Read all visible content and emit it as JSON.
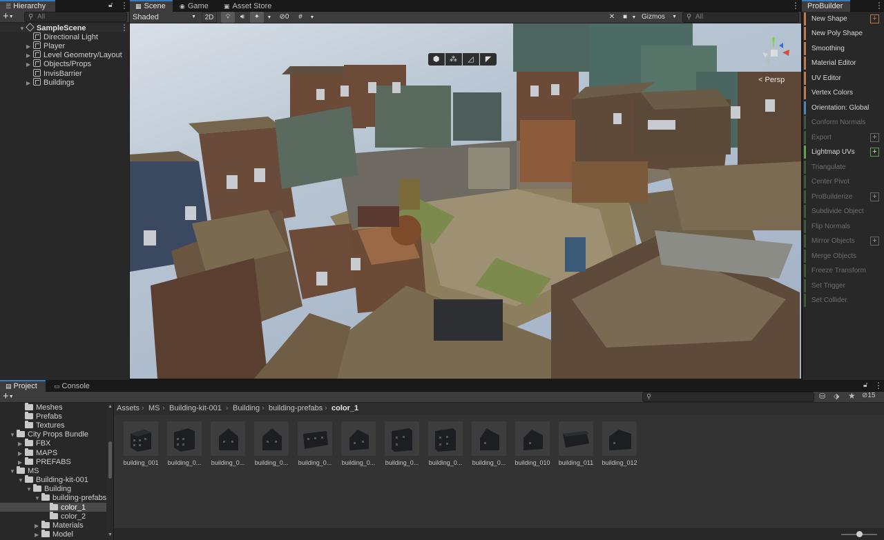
{
  "hierarchy": {
    "tab_label": "Hierarchy",
    "search_placeholder": "All",
    "scene_name": "SampleScene",
    "items": [
      {
        "label": "Directional Light",
        "foldable": false
      },
      {
        "label": "Player",
        "foldable": true
      },
      {
        "label": "Level Geometry/Layout",
        "foldable": true
      },
      {
        "label": "Objects/Props",
        "foldable": true
      },
      {
        "label": "InvisBarrier",
        "foldable": false
      },
      {
        "label": "Buildings",
        "foldable": true
      }
    ]
  },
  "scene_tabs": {
    "scene": "Scene",
    "game": "Game",
    "asset_store": "Asset Store"
  },
  "scene_toolbar": {
    "shading_mode": "Shaded",
    "two_d": "2D",
    "hidden_count": "0",
    "gizmos": "Gizmos",
    "search_placeholder": "All"
  },
  "scene_view": {
    "orientation_label": "< Persp"
  },
  "probuilder": {
    "title": "ProBuilder",
    "items": [
      {
        "label": "New Shape",
        "color": "#c07b4d",
        "enabled": true,
        "plus": true
      },
      {
        "label": "New Poly Shape",
        "color": "#c07b4d",
        "enabled": true,
        "plus": false
      },
      {
        "label": "Smoothing",
        "color": "#c07b4d",
        "enabled": true,
        "plus": false
      },
      {
        "label": "Material Editor",
        "color": "#c07b4d",
        "enabled": true,
        "plus": false
      },
      {
        "label": "UV Editor",
        "color": "#c07b4d",
        "enabled": true,
        "plus": false
      },
      {
        "label": "Vertex Colors",
        "color": "#c07b4d",
        "enabled": true,
        "plus": false
      },
      {
        "label": "Orientation: Global",
        "color": "#4a86b8",
        "enabled": true,
        "plus": false
      },
      {
        "label": "Conform Normals",
        "color": "#5a8a4e",
        "enabled": false,
        "plus": false
      },
      {
        "label": "Export",
        "color": "#5a8a4e",
        "enabled": false,
        "plus": true
      },
      {
        "label": "Lightmap UVs",
        "color": "#5fa24a",
        "enabled": true,
        "plus": true
      },
      {
        "label": "Triangulate",
        "color": "#5a8a4e",
        "enabled": false,
        "plus": false
      },
      {
        "label": "Center Pivot",
        "color": "#5a8a4e",
        "enabled": false,
        "plus": false
      },
      {
        "label": "ProBuilderize",
        "color": "#5a8a4e",
        "enabled": false,
        "plus": true
      },
      {
        "label": "Subdivide Object",
        "color": "#5a8a4e",
        "enabled": false,
        "plus": false
      },
      {
        "label": "Flip Normals",
        "color": "#5a8a4e",
        "enabled": false,
        "plus": false
      },
      {
        "label": "Mirror Objects",
        "color": "#5a8a4e",
        "enabled": false,
        "plus": true
      },
      {
        "label": "Merge Objects",
        "color": "#5a8a4e",
        "enabled": false,
        "plus": false
      },
      {
        "label": "Freeze Transform",
        "color": "#5a8a4e",
        "enabled": false,
        "plus": false
      },
      {
        "label": "Set Trigger",
        "color": "#5a8a4e",
        "enabled": false,
        "plus": false
      },
      {
        "label": "Set Collider",
        "color": "#5a8a4e",
        "enabled": false,
        "plus": false
      }
    ]
  },
  "bottom_tabs": {
    "project": "Project",
    "console": "Console"
  },
  "project": {
    "visible_count": "15",
    "tree": [
      {
        "label": "Meshes",
        "fold": ""
      },
      {
        "label": "Prefabs",
        "fold": ""
      },
      {
        "label": "Textures",
        "fold": ""
      },
      {
        "label": "City Props Bundle",
        "fold": "open"
      },
      {
        "label": "FBX",
        "fold": "closed"
      },
      {
        "label": "MAPS",
        "fold": "closed"
      },
      {
        "label": "PREFABS",
        "fold": "closed"
      },
      {
        "label": "MS",
        "fold": "open"
      },
      {
        "label": "Building-kit-001",
        "fold": "open"
      },
      {
        "label": "Building",
        "fold": "open"
      },
      {
        "label": "building-prefabs",
        "fold": "open"
      },
      {
        "label": "color_1",
        "fold": ""
      },
      {
        "label": "color_2",
        "fold": ""
      },
      {
        "label": "Materials",
        "fold": "closed"
      },
      {
        "label": "Model",
        "fold": "closed"
      }
    ],
    "breadcrumb": [
      "Assets",
      "MS",
      "Building-kit-001",
      "Building",
      "building-prefabs",
      "color_1"
    ],
    "assets": [
      {
        "label": "building_001"
      },
      {
        "label": "building_0..."
      },
      {
        "label": "building_0..."
      },
      {
        "label": "building_0..."
      },
      {
        "label": "building_0..."
      },
      {
        "label": "building_0..."
      },
      {
        "label": "building_0..."
      },
      {
        "label": "building_0..."
      },
      {
        "label": "building_0..."
      },
      {
        "label": "building_010"
      },
      {
        "label": "building_011"
      },
      {
        "label": "building_012"
      }
    ]
  }
}
